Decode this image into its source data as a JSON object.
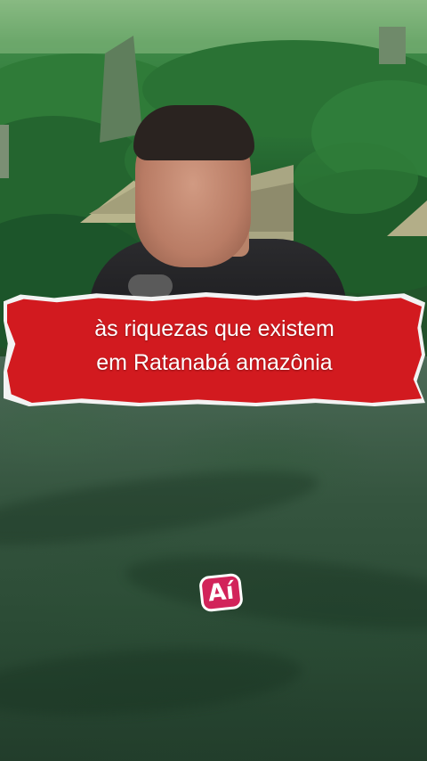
{
  "caption": {
    "line1": "às riquezas que existem",
    "line2": "em Ratanabá amazônia"
  },
  "sticker": {
    "text": "Aí"
  },
  "colors": {
    "banner_red": "#d21a1f",
    "banner_edge": "#f3f3f3",
    "sticker_pink": "#d2235a"
  },
  "scenes": {
    "top": "jungle-ruins-pyramids-with-speaker",
    "bottom": "aerial-rainforest-canopy"
  }
}
